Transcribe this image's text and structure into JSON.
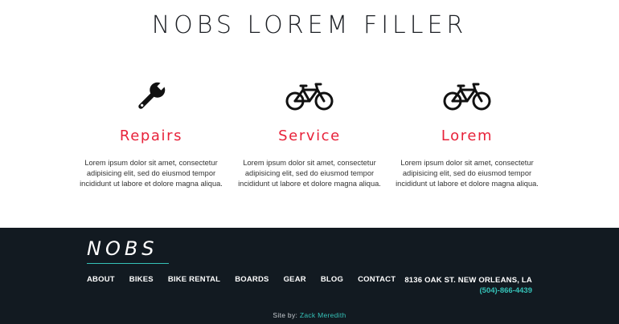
{
  "hero": {
    "title": "NOBS LOREM FILLER"
  },
  "features": [
    {
      "icon": "wrench-icon",
      "heading": "Repairs",
      "body": "Lorem ipsum dolor sit amet, consectetur adipisicing elit, sed do eiusmod tempor incididunt ut labore et dolore magna aliqua."
    },
    {
      "icon": "bicycle-icon",
      "heading": "Service",
      "body": "Lorem ipsum dolor sit amet, consectetur adipisicing elit, sed do eiusmod tempor incididunt ut labore et dolore magna aliqua."
    },
    {
      "icon": "bicycle-icon",
      "heading": "Lorem",
      "body": "Lorem ipsum dolor sit amet, consectetur adipisicing elit, sed do eiusmod tempor incididunt ut labore et dolore magna aliqua."
    }
  ],
  "footer": {
    "brand": "NOBS",
    "nav": [
      "ABOUT",
      "BIKES",
      "BIKE RENTAL",
      "BOARDS",
      "GEAR",
      "BLOG",
      "CONTACT"
    ],
    "address": "8136 OAK ST. NEW ORLEANS, LA",
    "phone": "(504)-866-4439",
    "credit_label": "Site by:",
    "credit_name": "Zack Meredith"
  },
  "colors": {
    "accent": "#e8223a",
    "teal": "#35c2b8",
    "footer_bg": "#121a21"
  }
}
